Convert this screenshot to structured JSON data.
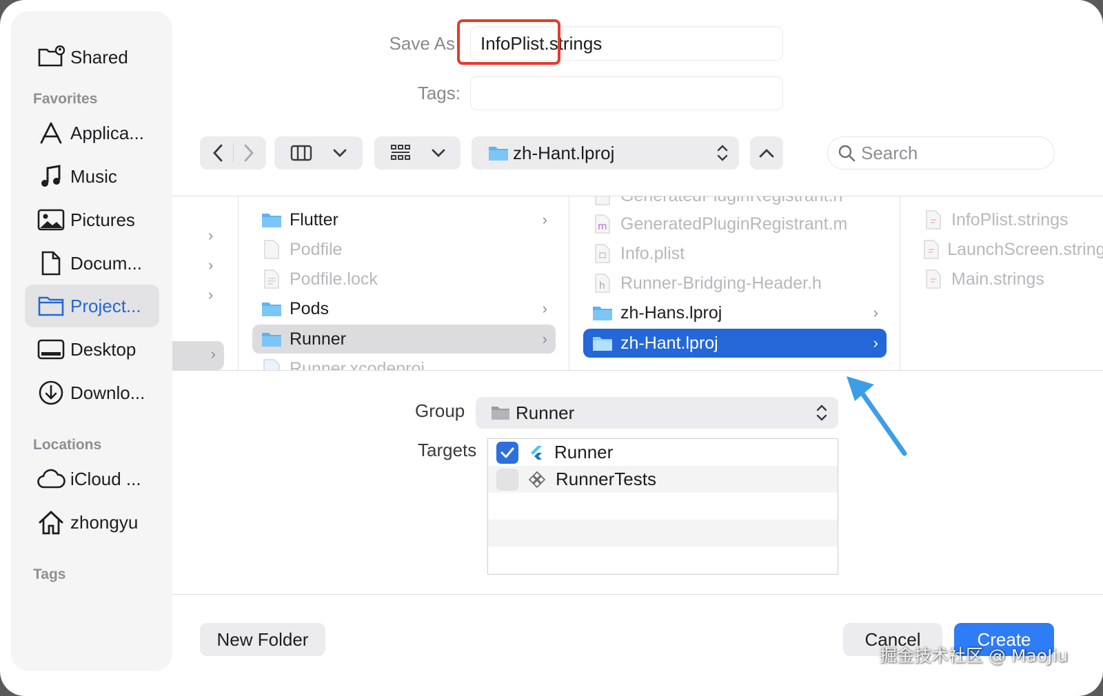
{
  "sidebar": {
    "shared_label": "Shared",
    "favorites_title": "Favorites",
    "favorites": [
      {
        "label": "Applica...",
        "icon": "applications-icon"
      },
      {
        "label": "Music",
        "icon": "music-icon"
      },
      {
        "label": "Pictures",
        "icon": "pictures-icon"
      },
      {
        "label": "Docum...",
        "icon": "document-icon"
      },
      {
        "label": "Project...",
        "icon": "folder-icon",
        "selected": true
      },
      {
        "label": "Desktop",
        "icon": "desktop-icon"
      },
      {
        "label": "Downlo...",
        "icon": "download-icon"
      }
    ],
    "locations_title": "Locations",
    "locations": [
      {
        "label": "iCloud ...",
        "icon": "cloud-icon"
      },
      {
        "label": "zhongyu",
        "icon": "home-icon"
      }
    ],
    "tags_title": "Tags"
  },
  "form": {
    "save_as_label": "Save As",
    "save_as_value": "InfoPlist.strings",
    "tags_label": "Tags:",
    "tags_value": ""
  },
  "toolbar": {
    "path_value": "zh-Hant.lproj",
    "search_placeholder": "Search"
  },
  "browser": {
    "column2": [
      {
        "label": "Flutter",
        "kind": "folder",
        "dim": false,
        "chevron": true
      },
      {
        "label": "Podfile",
        "kind": "file",
        "dim": true,
        "chevron": false
      },
      {
        "label": "Podfile.lock",
        "kind": "file",
        "dim": true,
        "chevron": false
      },
      {
        "label": "Pods",
        "kind": "folder",
        "dim": false,
        "chevron": true
      },
      {
        "label": "Runner",
        "kind": "folder",
        "dim": false,
        "chevron": true,
        "selected": "gray"
      },
      {
        "label": "Runner.xcodeproj",
        "kind": "file",
        "dim": true,
        "chevron": false
      }
    ],
    "column3": [
      {
        "label": "GeneratedPluginRegistrant.h",
        "kind": "file",
        "dim": true
      },
      {
        "label": "GeneratedPluginRegistrant.m",
        "kind": "file",
        "dim": true
      },
      {
        "label": "Info.plist",
        "kind": "file",
        "dim": true
      },
      {
        "label": "Runner-Bridging-Header.h",
        "kind": "file",
        "dim": true
      },
      {
        "label": "zh-Hans.lproj",
        "kind": "folder",
        "dim": false,
        "chevron": true
      },
      {
        "label": "zh-Hant.lproj",
        "kind": "folder",
        "dim": false,
        "chevron": true,
        "selected": "blue"
      }
    ],
    "column4": [
      {
        "label": "InfoPlist.strings",
        "kind": "file",
        "dim": true
      },
      {
        "label": "LaunchScreen.strings",
        "kind": "file",
        "dim": true
      },
      {
        "label": "Main.strings",
        "kind": "file",
        "dim": true
      }
    ]
  },
  "options": {
    "group_label": "Group",
    "group_value": "Runner",
    "targets_label": "Targets",
    "targets": [
      {
        "label": "Runner",
        "checked": true
      },
      {
        "label": "RunnerTests",
        "checked": false
      }
    ]
  },
  "buttons": {
    "new_folder": "New Folder",
    "cancel": "Cancel",
    "create": "Create"
  },
  "watermark": "掘金技术社区 @ MaoJiu",
  "colors": {
    "accent": "#2367d8",
    "create_button": "#2e7cf6",
    "highlight": "#e53a2c",
    "arrow": "#3d9ee8"
  }
}
